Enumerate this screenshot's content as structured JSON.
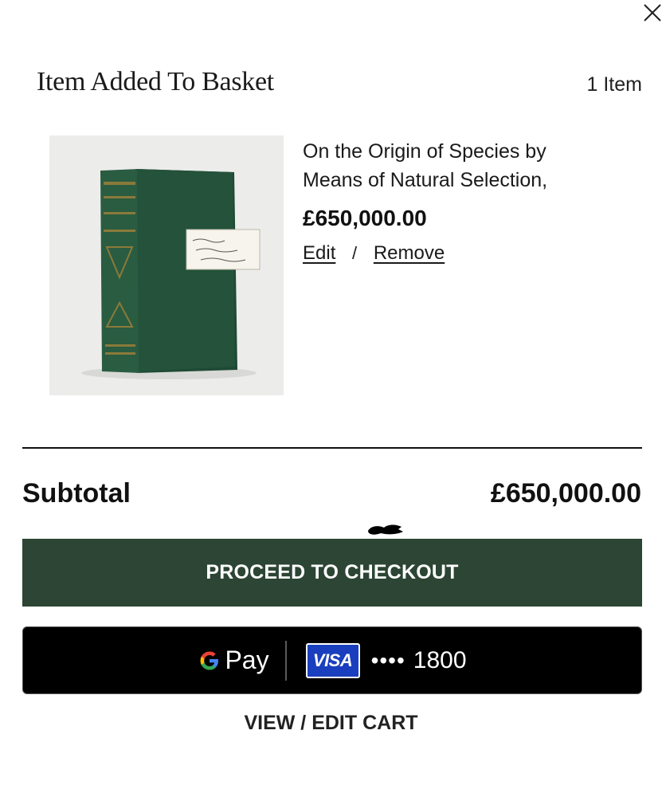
{
  "header": {
    "title": "Item Added To Basket",
    "item_count": "1 Item"
  },
  "product": {
    "name": "On the Origin of Species by Means of Natural Selection,",
    "price": "£650,000.00",
    "edit_label": "Edit",
    "separator": "/",
    "remove_label": "Remove",
    "image_alt": "green cloth-bound book"
  },
  "summary": {
    "subtotal_label": "Subtotal",
    "subtotal_value": "£650,000.00"
  },
  "buttons": {
    "checkout_label": "PROCEED TO CHECKOUT",
    "gpay": {
      "g": "G",
      "pay": "Pay",
      "card_brand": "VISA",
      "card_dots": "••••",
      "card_last4": "1800"
    },
    "view_cart_label": "VIEW / EDIT CART"
  },
  "icons": {
    "close": "close-icon",
    "google": "google-g-icon",
    "visa": "visa-card-icon"
  },
  "colors": {
    "checkout_bg": "#2c4534",
    "gpay_bg": "#000000",
    "visa_blue": "#1a3fbe"
  }
}
